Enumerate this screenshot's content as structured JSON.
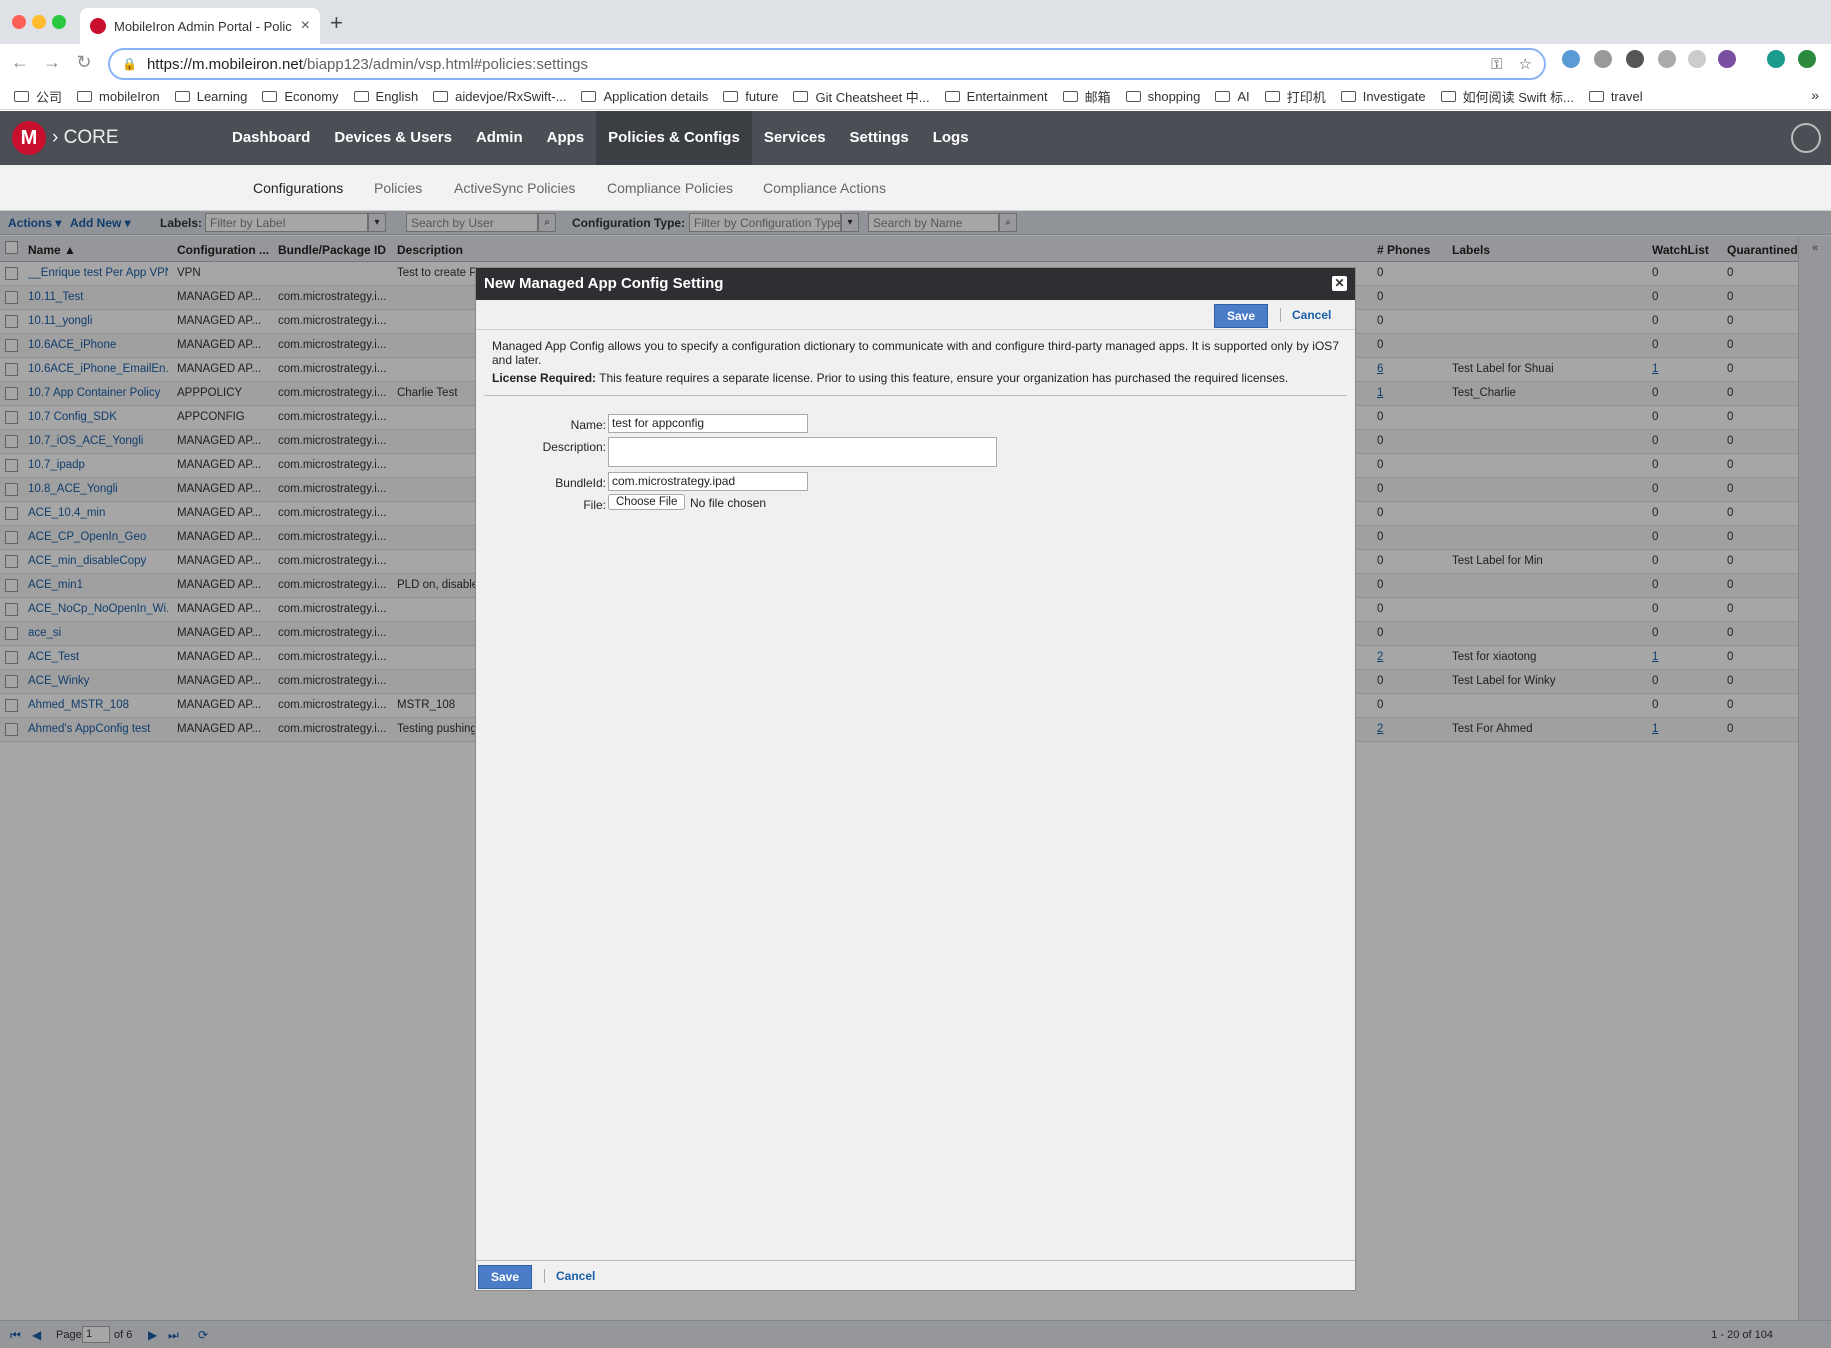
{
  "browser": {
    "tab_title": "MobileIron Admin Portal - Polic",
    "url_host": "https://m.mobileiron.net",
    "url_path": "/biapp123/admin/vsp.html#policies:settings",
    "bookmarks": [
      "公司",
      "mobileIron",
      "Learning",
      "Economy",
      "English",
      "aidevjoe/RxSwift-...",
      "Application details",
      "future",
      "Git Cheatsheet 中...",
      "Entertainment",
      "邮箱",
      "shopping",
      "AI",
      "打印机",
      "Investigate",
      "如何阅读 Swift 标...",
      "travel"
    ]
  },
  "app": {
    "brand": "CORE",
    "brand_sep": "›",
    "nav": [
      "Dashboard",
      "Devices & Users",
      "Admin",
      "Apps",
      "Policies & Configs",
      "Services",
      "Settings",
      "Logs"
    ],
    "subnav": [
      "Configurations",
      "Policies",
      "ActiveSync Policies",
      "Compliance Policies",
      "Compliance Actions"
    ]
  },
  "filters": {
    "actions": "Actions ▾",
    "add_new": "Add New ▾",
    "labels_label": "Labels:",
    "labels_placeholder": "Filter by Label",
    "user_placeholder": "Search by User",
    "config_type_label": "Configuration Type:",
    "config_type_placeholder": "Filter by Configuration Type",
    "name_placeholder": "Search by Name"
  },
  "grid": {
    "headers": [
      "Name ▲",
      "Configuration ...",
      "Bundle/Package ID",
      "Description",
      "# Phones",
      "Labels",
      "WatchList",
      "Quarantined"
    ],
    "rows": [
      {
        "name": "__Enrique test Per App VPN",
        "type": "VPN",
        "bundle": "",
        "desc": "Test to create Pe",
        "phones": "0",
        "label": "",
        "watch": "0",
        "quar": "0"
      },
      {
        "name": "10.11_Test",
        "type": "MANAGED AP...",
        "bundle": "com.microstrategy.i...",
        "desc": "",
        "phones": "0",
        "label": "",
        "watch": "0",
        "quar": "0"
      },
      {
        "name": "10.11_yongli",
        "type": "MANAGED AP...",
        "bundle": "com.microstrategy.i...",
        "desc": "",
        "phones": "0",
        "label": "",
        "watch": "0",
        "quar": "0"
      },
      {
        "name": "10.6ACE_iPhone",
        "type": "MANAGED AP...",
        "bundle": "com.microstrategy.i...",
        "desc": "",
        "phones": "0",
        "label": "",
        "watch": "0",
        "quar": "0"
      },
      {
        "name": "10.6ACE_iPhone_EmailEn...",
        "type": "MANAGED AP...",
        "bundle": "com.microstrategy.i...",
        "desc": "",
        "phones": "6",
        "label": "Test Label for Shuai",
        "watch": "1",
        "quar": "0"
      },
      {
        "name": "10.7 App Container Policy",
        "type": "APPPOLICY",
        "bundle": "com.microstrategy.i...",
        "desc": "Charlie Test",
        "phones": "1",
        "label": "Test_Charlie",
        "watch": "0",
        "quar": "0"
      },
      {
        "name": "10.7 Config_SDK",
        "type": "APPCONFIG",
        "bundle": "com.microstrategy.i...",
        "desc": "",
        "phones": "0",
        "label": "",
        "watch": "0",
        "quar": "0"
      },
      {
        "name": "10.7_iOS_ACE_Yongli",
        "type": "MANAGED AP...",
        "bundle": "com.microstrategy.i...",
        "desc": "",
        "phones": "0",
        "label": "",
        "watch": "0",
        "quar": "0"
      },
      {
        "name": "10.7_ipadp",
        "type": "MANAGED AP...",
        "bundle": "com.microstrategy.i...",
        "desc": "",
        "phones": "0",
        "label": "",
        "watch": "0",
        "quar": "0"
      },
      {
        "name": "10.8_ACE_Yongli",
        "type": "MANAGED AP...",
        "bundle": "com.microstrategy.i...",
        "desc": "",
        "phones": "0",
        "label": "",
        "watch": "0",
        "quar": "0"
      },
      {
        "name": "ACE_10.4_min",
        "type": "MANAGED AP...",
        "bundle": "com.microstrategy.i...",
        "desc": "",
        "phones": "0",
        "label": "",
        "watch": "0",
        "quar": "0"
      },
      {
        "name": "ACE_CP_OpenIn_Geo",
        "type": "MANAGED AP...",
        "bundle": "com.microstrategy.i...",
        "desc": "",
        "phones": "0",
        "label": "",
        "watch": "0",
        "quar": "0"
      },
      {
        "name": "ACE_min_disableCopy",
        "type": "MANAGED AP...",
        "bundle": "com.microstrategy.i...",
        "desc": "",
        "phones": "0",
        "label": "Test Label for Min",
        "watch": "0",
        "quar": "0"
      },
      {
        "name": "ACE_min1",
        "type": "MANAGED AP...",
        "bundle": "com.microstrategy.i...",
        "desc": "PLD on, disable",
        "phones": "0",
        "label": "",
        "watch": "0",
        "quar": "0"
      },
      {
        "name": "ACE_NoCp_NoOpenIn_Wi...",
        "type": "MANAGED AP...",
        "bundle": "com.microstrategy.i...",
        "desc": "",
        "phones": "0",
        "label": "",
        "watch": "0",
        "quar": "0"
      },
      {
        "name": "ace_si",
        "type": "MANAGED AP...",
        "bundle": "com.microstrategy.i...",
        "desc": "",
        "phones": "0",
        "label": "",
        "watch": "0",
        "quar": "0"
      },
      {
        "name": "ACE_Test",
        "type": "MANAGED AP...",
        "bundle": "com.microstrategy.i...",
        "desc": "",
        "phones": "2",
        "label": "Test for xiaotong",
        "watch": "1",
        "quar": "0"
      },
      {
        "name": "ACE_Winky",
        "type": "MANAGED AP...",
        "bundle": "com.microstrategy.i...",
        "desc": "",
        "phones": "0",
        "label": "Test Label for Winky",
        "watch": "0",
        "quar": "0"
      },
      {
        "name": "Ahmed_MSTR_108",
        "type": "MANAGED AP...",
        "bundle": "com.microstrategy.i...",
        "desc": "MSTR_108",
        "phones": "0",
        "label": "",
        "watch": "0",
        "quar": "0"
      },
      {
        "name": "Ahmed's AppConfig test",
        "type": "MANAGED AP...",
        "bundle": "com.microstrategy.i...",
        "desc": "Testing pushing",
        "phones": "2",
        "label": "Test For Ahmed",
        "watch": "1",
        "quar": "0"
      }
    ]
  },
  "pager": {
    "page_label": "Page",
    "page_value": "1",
    "of_label": "of 6",
    "summary": "1 - 20 of 104"
  },
  "modal": {
    "title": "New Managed App Config Setting",
    "close": "✕",
    "save": "Save",
    "cancel": "Cancel",
    "info_text": "Managed App Config allows you to specify a configuration dictionary to communicate with and configure third-party managed apps. It is supported only by iOS7 and later.",
    "license_label": "License Required:",
    "license_text": " This feature requires a separate license. Prior to using this feature, ensure your organization has purchased the required licenses.",
    "name_label": "Name:",
    "name_value": "test for appconfig",
    "description_label": "Description:",
    "description_value": "",
    "bundle_label": "BundleId:",
    "bundle_value": "com.microstrategy.ipad",
    "file_label": "File:",
    "choose_file": "Choose File",
    "no_file": "No file chosen"
  }
}
